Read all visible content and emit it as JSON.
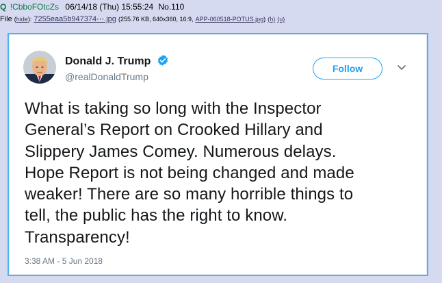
{
  "post": {
    "q_mark": "Q",
    "tripcode": "!CbboFOtcZs",
    "date": "06/14/18 (Thu) 15:55:24",
    "number": "No.110",
    "file_prefix": "File",
    "hide_label": "hide",
    "file_name": "7255eaa5b947374⋯.jpg",
    "file_info": "(255.76 KB, 640x360, 16:9,",
    "original_name": "APP-060518-POTUS.jpg",
    "h_label": "(h)",
    "u_label": "(u)"
  },
  "tweet": {
    "display_name": "Donald J. Trump",
    "handle": "@realDonaldTrump",
    "follow_label": "Follow",
    "text_lines": [
      "What is taking so long with the Inspector",
      "General’s Report on Crooked Hillary and",
      "Slippery James Comey. Numerous delays.",
      "Hope Report is not being changed and made",
      "weaker! There are so many horrible things to",
      "tell, the public has the right to know.",
      "Transparency!"
    ],
    "timestamp": "3:38 AM - 5 Jun 2018"
  },
  "colors": {
    "accent": "#1da1f2",
    "frame_border": "#4ab3f4",
    "name_green": "#117743",
    "board_bg": "#d6daf0"
  },
  "icons": {
    "verified": "verified-badge-icon",
    "caret": "chevron-down-icon"
  }
}
